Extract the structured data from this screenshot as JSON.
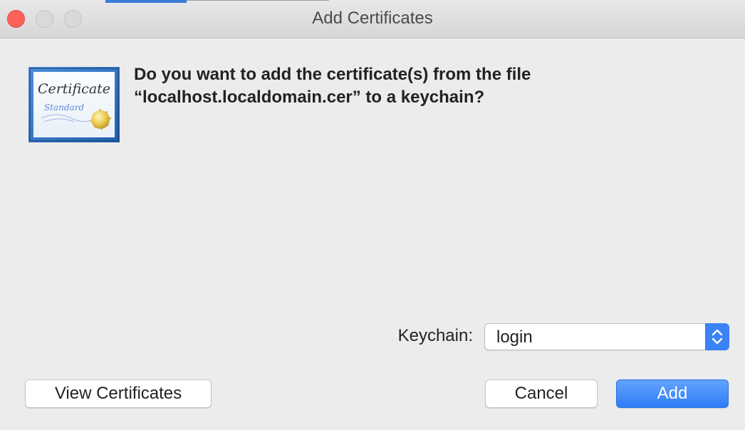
{
  "window": {
    "title": "Add Certificates",
    "controls": [
      "close",
      "minimize",
      "zoom"
    ]
  },
  "icon": {
    "name": "certificate-icon",
    "text_main": "Certificate",
    "text_sub": "Standard"
  },
  "dialog": {
    "message_line1": "Do you want to add the certificate(s) from the file",
    "message_line2": "“localhost.localdomain.cer” to a keychain?"
  },
  "keychain": {
    "label": "Keychain:",
    "value": "login"
  },
  "buttons": {
    "view_certificates": "View Certificates",
    "cancel": "Cancel",
    "add": "Add"
  },
  "colors": {
    "accent": "#3b82f7",
    "close": "#fc605b",
    "background": "#ececec"
  }
}
